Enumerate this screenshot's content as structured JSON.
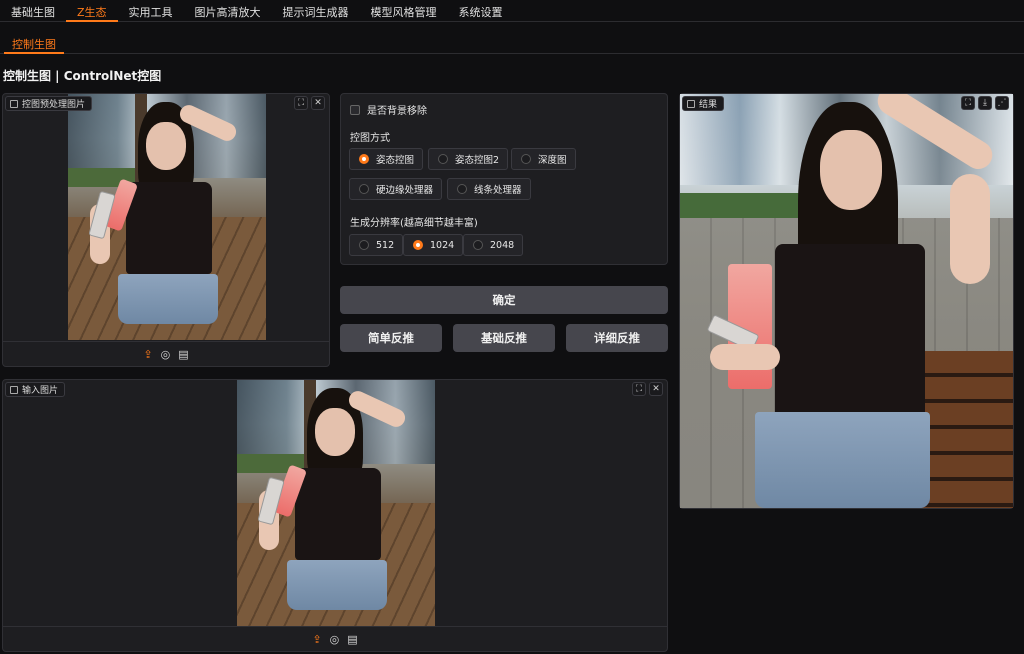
{
  "topnav": {
    "items": [
      {
        "label": "基础生图",
        "active": false
      },
      {
        "label": "Z生态",
        "active": true
      },
      {
        "label": "实用工具",
        "active": false
      },
      {
        "label": "图片高清放大",
        "active": false
      },
      {
        "label": "提示词生成器",
        "active": false
      },
      {
        "label": "模型风格管理",
        "active": false
      },
      {
        "label": "系统设置",
        "active": false
      }
    ]
  },
  "subnav": {
    "active_label": "控制生图"
  },
  "page": {
    "title": "控制生图 | ControlNet控图"
  },
  "preview_panel": {
    "label": "控图预处理图片"
  },
  "input_panel": {
    "label": "输入图片"
  },
  "result_panel": {
    "label": "结果"
  },
  "options": {
    "remove_bg_label": "是否背景移除",
    "remove_bg_checked": false,
    "control_mode_label": "控图方式",
    "control_modes": [
      {
        "label": "姿态控图",
        "selected": true
      },
      {
        "label": "姿态控图2",
        "selected": false
      },
      {
        "label": "深度图",
        "selected": false
      },
      {
        "label": "硬边缘处理器",
        "selected": false
      },
      {
        "label": "线条处理器",
        "selected": false
      }
    ],
    "resolution_label": "生成分辨率(越高细节越丰富)",
    "resolutions": [
      {
        "label": "512",
        "selected": false
      },
      {
        "label": "1024",
        "selected": true
      },
      {
        "label": "2048",
        "selected": false
      }
    ]
  },
  "buttons": {
    "confirm": "确定",
    "simple_reverse": "简单反推",
    "basic_reverse": "基础反推",
    "detail_reverse": "详细反推"
  },
  "colors": {
    "accent": "#ff7a1a",
    "panel_bg": "#1e1e21",
    "button_bg": "#46464d"
  }
}
